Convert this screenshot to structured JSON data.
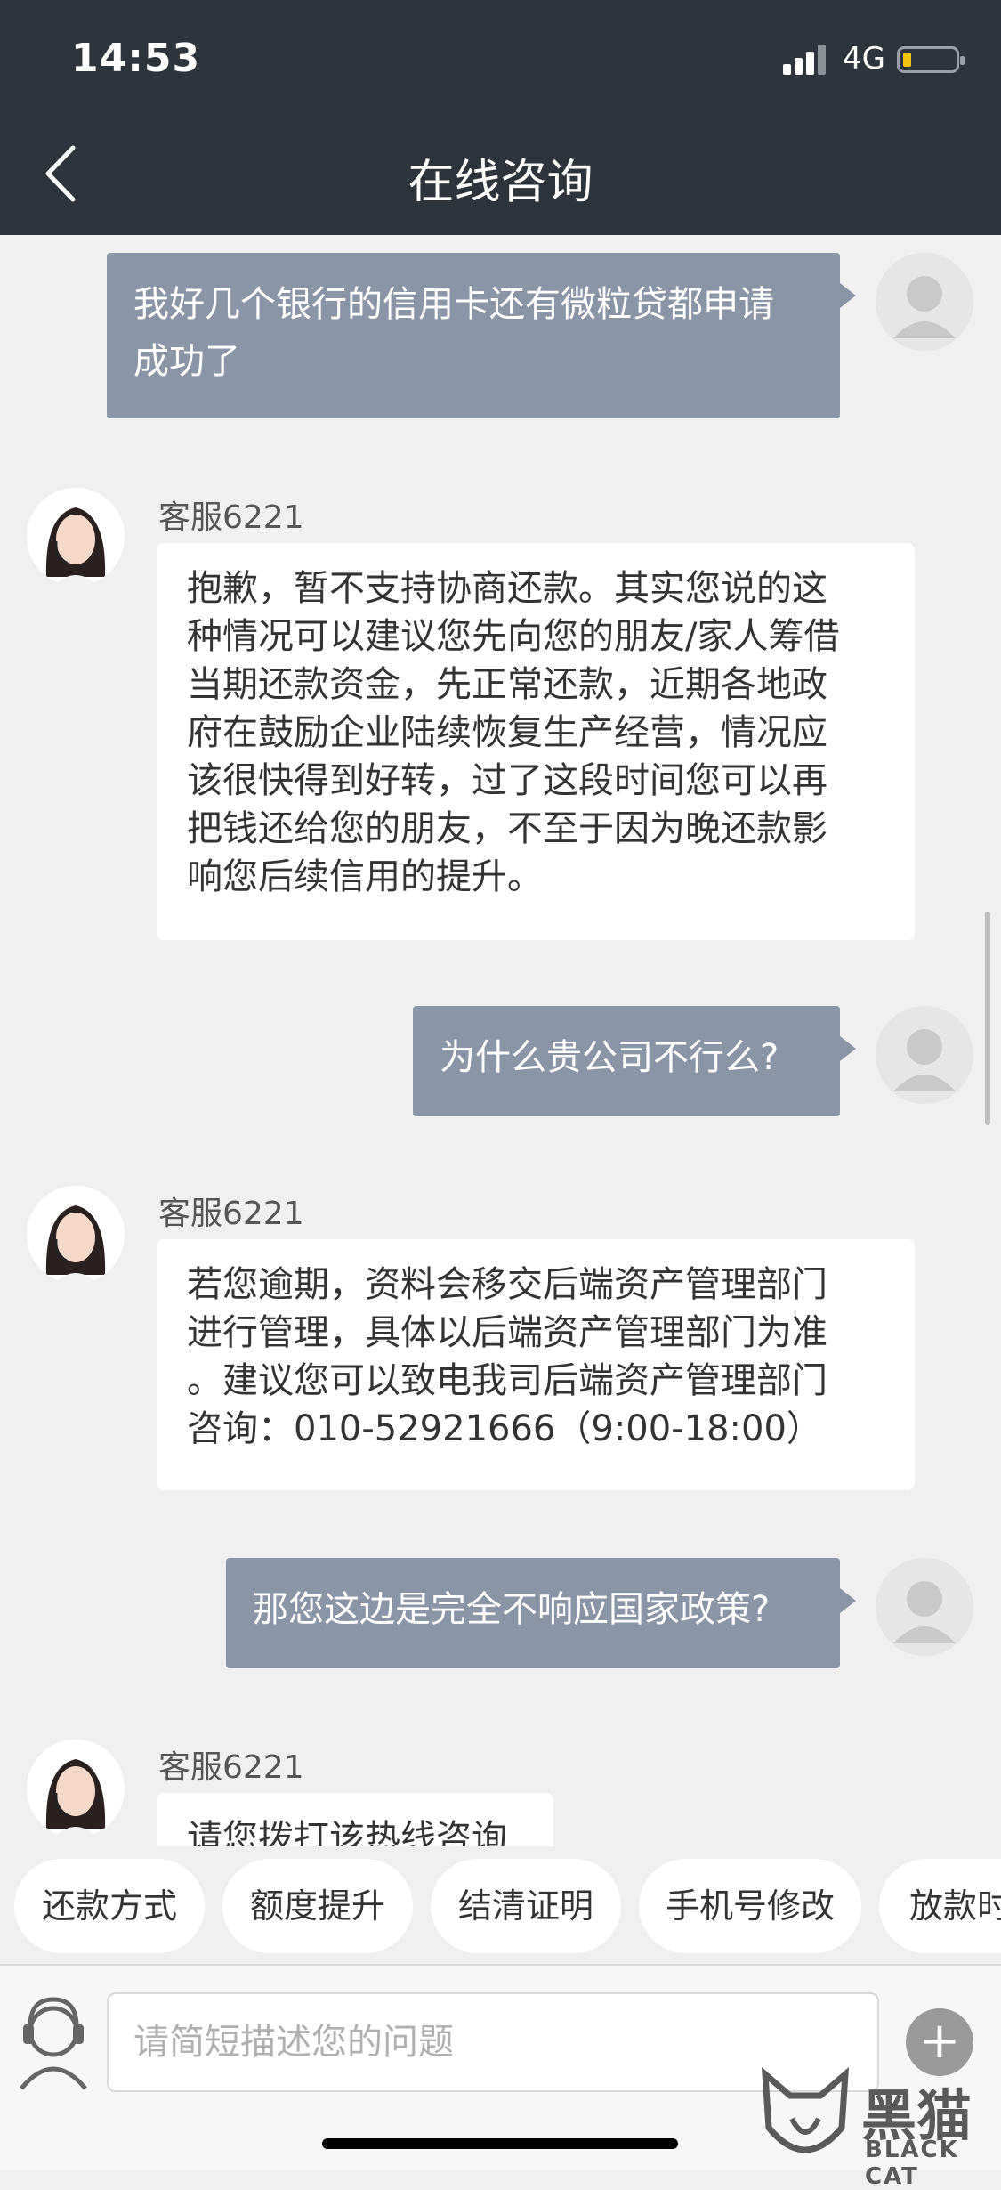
{
  "status_bar": {
    "time": "14:53",
    "network": "4G"
  },
  "header": {
    "title": "在线咨询"
  },
  "messages": [
    {
      "from": "user",
      "lines": [
        "我好几个银行的信用卡还有微粒贷都申请",
        "成功了"
      ]
    },
    {
      "from": "agent",
      "name": "客服6221",
      "lines": [
        "抱歉，暂不支持协商还款。其实您说的这",
        "种情况可以建议您先向您的朋友/家人筹借",
        "当期还款资金，先正常还款，近期各地政",
        "府在鼓励企业陆续恢复生产经营，情况应",
        "该很快得到好转，过了这段时间您可以再",
        "把钱还给您的朋友，不至于因为晚还款影",
        "响您后续信用的提升。"
      ]
    },
    {
      "from": "user",
      "lines": [
        "为什么贵公司不行么?"
      ]
    },
    {
      "from": "agent",
      "name": "客服6221",
      "lines": [
        "若您逾期，资料会移交后端资产管理部门",
        "进行管理，具体以后端资产管理部门为准",
        "。建议您可以致电我司后端资产管理部门",
        "咨询：010-52921666（9:00-18:00）"
      ]
    },
    {
      "from": "user",
      "lines": [
        "那您这边是完全不响应国家政策?"
      ]
    },
    {
      "from": "agent",
      "name": "客服6221",
      "lines": [
        "请您拨打该热线咨询"
      ]
    }
  ],
  "quick_replies": [
    "还款方式",
    "额度提升",
    "结清证明",
    "手机号修改",
    "放款时"
  ],
  "input": {
    "placeholder": "请简短描述您的问题"
  },
  "watermark": {
    "text": "黑猫",
    "sub": "BLACK CAT"
  }
}
